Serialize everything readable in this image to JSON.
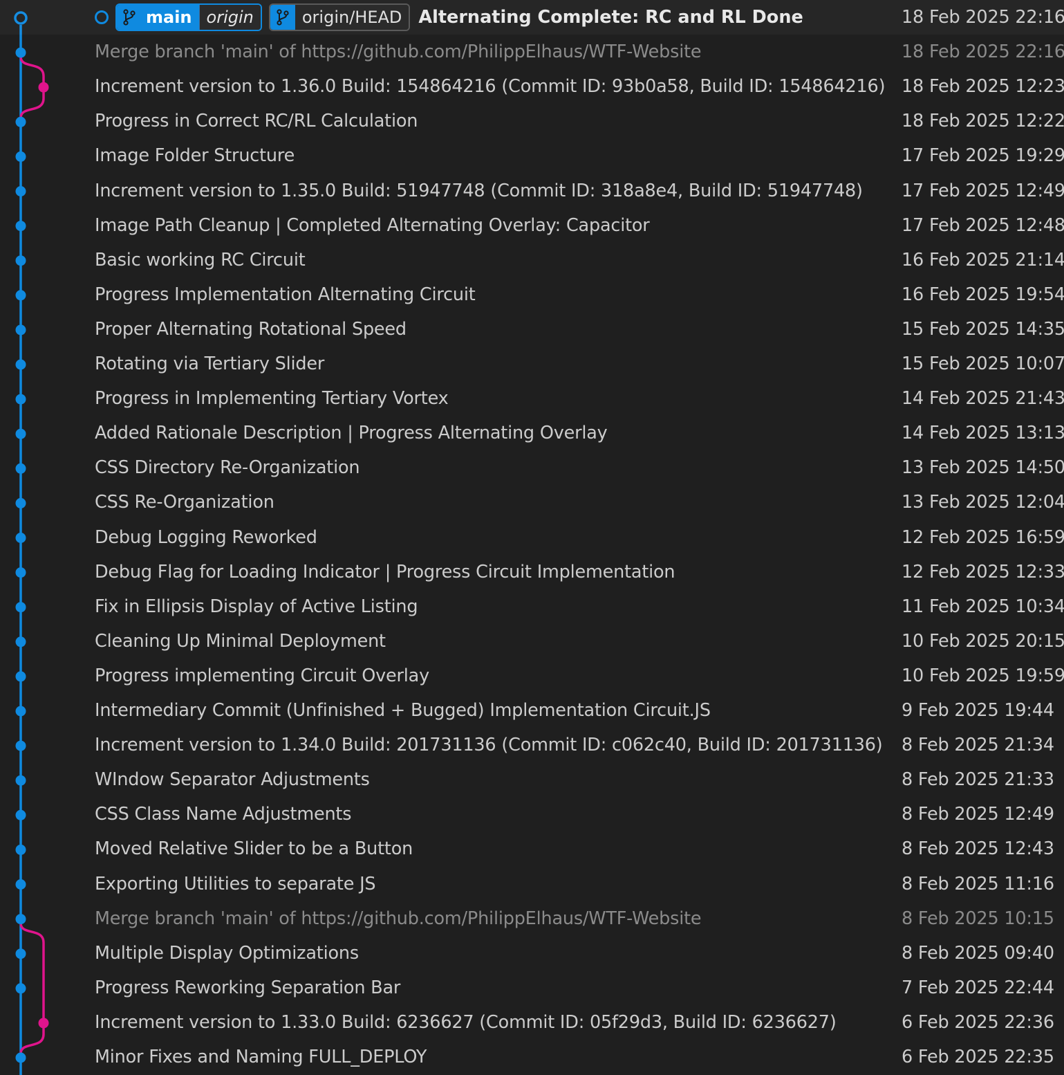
{
  "colors": {
    "background": "#1f1f1f",
    "graph_main": "#0f8ae0",
    "graph_branch": "#e0148c",
    "text": "#cccccc",
    "merge_text": "#8b8b8b"
  },
  "head": {
    "refs": {
      "local_branch": "main",
      "local_remote": "origin",
      "remote_head": "origin/HEAD"
    },
    "icons": {
      "branch": "git-branch-icon",
      "head": "current-commit-circle-icon"
    }
  },
  "commits": [
    {
      "message": "Alternating Complete: RC and RL Done",
      "date": "18 Feb 2025 22:16",
      "is_head": true
    },
    {
      "message": "Merge branch 'main' of https://github.com/PhilippElhaus/WTF-Website",
      "date": "18 Feb 2025 22:16",
      "is_merge": true
    },
    {
      "message": "Increment version to 1.36.0 Build: 154864216 (Commit ID: 93b0a58, Build ID: 154864216)",
      "date": "18 Feb 2025 12:23"
    },
    {
      "message": "Progress in Correct RC/RL Calculation",
      "date": "18 Feb 2025 12:22"
    },
    {
      "message": "Image Folder Structure",
      "date": "17 Feb 2025 19:29"
    },
    {
      "message": "Increment version to 1.35.0 Build: 51947748 (Commit ID: 318a8e4, Build ID: 51947748)",
      "date": "17 Feb 2025 12:49"
    },
    {
      "message": "Image Path Cleanup | Completed Alternating Overlay: Capacitor",
      "date": "17 Feb 2025 12:48"
    },
    {
      "message": "Basic working RC Circuit",
      "date": "16 Feb 2025 21:14"
    },
    {
      "message": "Progress Implementation Alternating Circuit",
      "date": "16 Feb 2025 19:54"
    },
    {
      "message": "Proper Alternating Rotational Speed",
      "date": "15 Feb 2025 14:35"
    },
    {
      "message": "Rotating via Tertiary Slider",
      "date": "15 Feb 2025 10:07"
    },
    {
      "message": "Progress in Implementing Tertiary Vortex",
      "date": "14 Feb 2025 21:43"
    },
    {
      "message": "Added Rationale Description | Progress Alternating Overlay",
      "date": "14 Feb 2025 13:13"
    },
    {
      "message": "CSS Directory Re-Organization",
      "date": "13 Feb 2025 14:50"
    },
    {
      "message": "CSS Re-Organization",
      "date": "13 Feb 2025 12:04"
    },
    {
      "message": "Debug Logging Reworked",
      "date": "12 Feb 2025 16:59"
    },
    {
      "message": "Debug Flag for Loading Indicator | Progress Circuit Implementation",
      "date": "12 Feb 2025 12:33"
    },
    {
      "message": "Fix in Ellipsis Display of Active Listing",
      "date": "11 Feb 2025 10:34"
    },
    {
      "message": "Cleaning Up Minimal Deployment",
      "date": "10 Feb 2025 20:15"
    },
    {
      "message": "Progress implementing Circuit Overlay",
      "date": "10 Feb 2025 19:59"
    },
    {
      "message": "Intermediary Commit (Unfinished + Bugged) Implementation Circuit.JS",
      "date": "9 Feb 2025 19:44"
    },
    {
      "message": "Increment version to 1.34.0 Build: 201731136 (Commit ID: c062c40, Build ID: 201731136)",
      "date": "8 Feb 2025 21:34"
    },
    {
      "message": "WIndow Separator Adjustments",
      "date": "8 Feb 2025 21:33"
    },
    {
      "message": "CSS Class Name Adjustments",
      "date": "8 Feb 2025 12:49"
    },
    {
      "message": "Moved Relative Slider to be a Button",
      "date": "8 Feb 2025 12:43"
    },
    {
      "message": "Exporting Utilities to separate JS",
      "date": "8 Feb 2025 11:16"
    },
    {
      "message": "Merge branch 'main' of https://github.com/PhilippElhaus/WTF-Website",
      "date": "8 Feb 2025 10:15",
      "is_merge": true
    },
    {
      "message": "Multiple Display Optimizations",
      "date": "8 Feb 2025 09:40"
    },
    {
      "message": "Progress Reworking Separation Bar",
      "date": "7 Feb 2025 22:44"
    },
    {
      "message": "Increment version to 1.33.0 Build: 6236627 (Commit ID: 05f29d3, Build ID: 6236627)",
      "date": "6 Feb 2025 22:36",
      "on_branch": true
    },
    {
      "message": "Minor Fixes and Naming FULL_DEPLOY",
      "date": "6 Feb 2025 22:35"
    }
  ]
}
